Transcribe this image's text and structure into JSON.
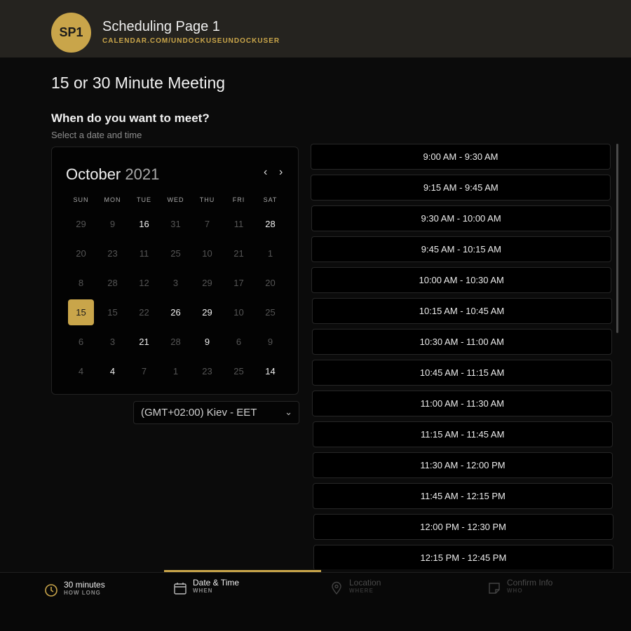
{
  "header": {
    "avatar_text": "SP1",
    "page_name": "Scheduling Page 1",
    "url": "CALENDAR.COM/UNDOCKUSEUNDOCKUSER"
  },
  "meeting": {
    "title": "15 or 30 Minute Meeting",
    "question": "When do you want to meet?",
    "hint": "Select a date and time"
  },
  "calendar": {
    "month": "October",
    "year": "2021",
    "prev_icon": "chevron-left-icon",
    "next_icon": "chevron-right-icon",
    "weekdays": [
      "SUN",
      "MON",
      "TUE",
      "WED",
      "THU",
      "FRI",
      "SAT"
    ],
    "weeks": [
      [
        "29",
        "9",
        "16",
        "31",
        "7",
        "11",
        "28"
      ],
      [
        "20",
        "23",
        "11",
        "25",
        "10",
        "21",
        "1"
      ],
      [
        "8",
        "28",
        "12",
        "3",
        "29",
        "17",
        "20"
      ],
      [
        "15",
        "15",
        "22",
        "26",
        "29",
        "10",
        "25"
      ],
      [
        "6",
        "3",
        "21",
        "28",
        "9",
        "6",
        "9"
      ],
      [
        "4",
        "4",
        "7",
        "1",
        "23",
        "25",
        "14"
      ]
    ],
    "selected": "15"
  },
  "timezone": {
    "value": "(GMT+02:00) Kiev - EET",
    "icon": "chevron-down-icon"
  },
  "slots": [
    "9:00 AM - 9:30 AM",
    "9:15 AM - 9:45 AM",
    "9:30 AM - 10:00 AM",
    "9:45 AM - 10:15 AM",
    "10:00 AM - 10:30 AM",
    "10:15 AM - 10:45 AM",
    "10:30 AM - 11:00 AM",
    "10:45 AM - 11:15 AM",
    "11:00 AM - 11:30 AM",
    "11:15 AM - 11:45 AM",
    "11:30 AM - 12:00 PM",
    "11:45 AM - 12:15 PM",
    "12:00 PM - 12:30 PM",
    "12:15 PM - 12:45 PM"
  ],
  "steps": [
    {
      "label": "30 minutes",
      "sub": "HOW LONG",
      "icon": "clock-icon"
    },
    {
      "label": "Date & Time",
      "sub": "WHEN",
      "icon": "calendar-icon"
    },
    {
      "label": "Location",
      "sub": "WHERE",
      "icon": "location-pin-icon"
    },
    {
      "label": "Confirm Info",
      "sub": "WHO",
      "icon": "note-icon"
    }
  ],
  "colors": {
    "accent": "#c9a54a",
    "background": "#0b0b0b",
    "header": "#25231f"
  }
}
